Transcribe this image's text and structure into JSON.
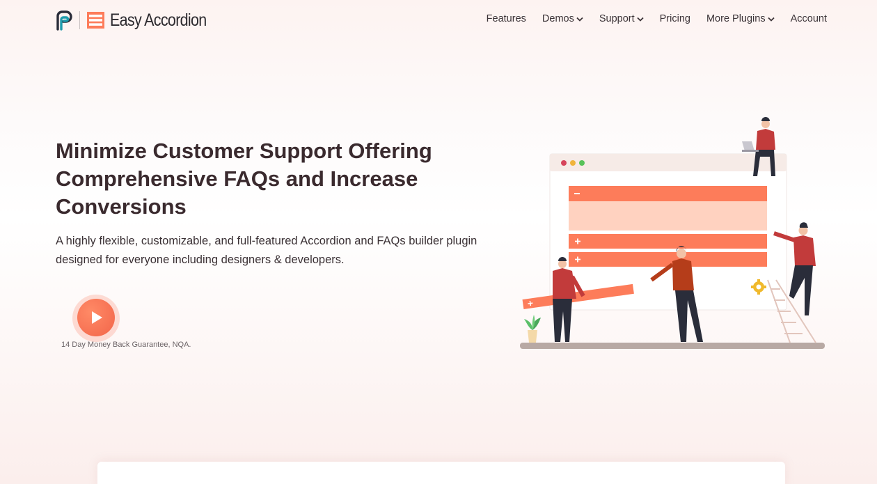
{
  "header": {
    "brand_name": "Easy Accordion",
    "nav": [
      {
        "label": "Features",
        "has_dropdown": false
      },
      {
        "label": "Demos",
        "has_dropdown": true
      },
      {
        "label": "Support",
        "has_dropdown": true
      },
      {
        "label": "Pricing",
        "has_dropdown": false
      },
      {
        "label": "More Plugins",
        "has_dropdown": true
      },
      {
        "label": "Account",
        "has_dropdown": false
      }
    ]
  },
  "hero": {
    "title": "Minimize Customer Support Offering Comprehensive FAQs and Increase Conversions",
    "subtitle": "A highly flexible, customizable, and full-featured Accordion and FAQs builder plugin designed for everyone including designers & developers.",
    "play_icon": "play-icon",
    "guarantee": "14 Day Money Back Guarantee, NQA."
  },
  "colors": {
    "accent": "#fd7c5a",
    "accent_light": "#ffd2c0",
    "brand_teal": "#1e9cad",
    "text_dark": "#3a2a2e"
  }
}
